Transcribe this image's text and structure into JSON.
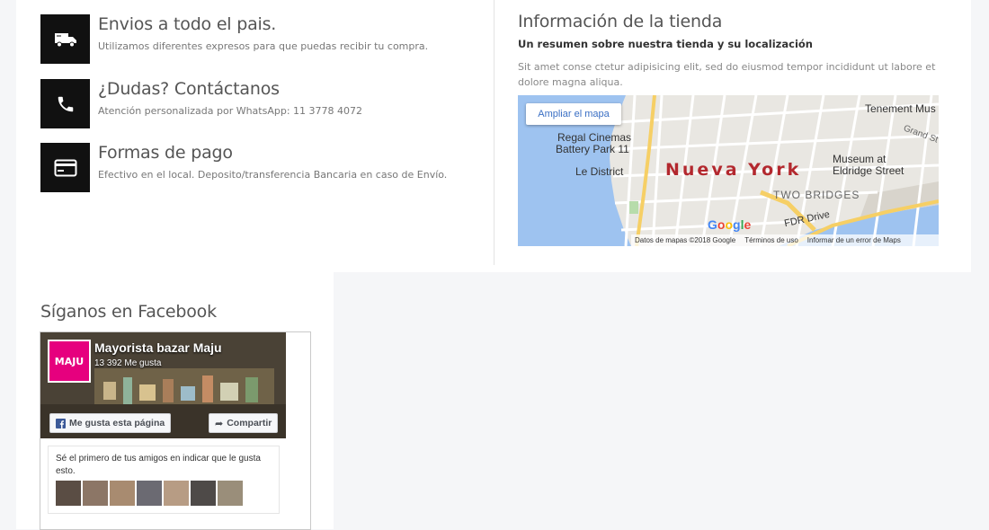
{
  "features": [
    {
      "icon": "truck-icon",
      "title": "Envios a todo el pais.",
      "description": "Utilizamos diferentes expresos para que puedas recibir tu compra."
    },
    {
      "icon": "phone-icon",
      "title": "¿Dudas? Contáctanos",
      "description": "Atención personalizada por WhatsApp: 11 3778 4072"
    },
    {
      "icon": "credit-card-icon",
      "title": "Formas de pago",
      "description": "Efectivo en el local. Deposito/transferencia Bancaria en caso de Envío."
    }
  ],
  "store": {
    "title": "Información de la tienda",
    "subtitle": "Un resumen sobre nuestra tienda y su localización",
    "text": "Sit amet conse ctetur adipisicing elit, sed do eiusmod tempor incididunt ut labore et dolore magna aliqua."
  },
  "map": {
    "enlarge_label": "Ampliar el mapa",
    "labels": {
      "city": "Nueva York",
      "regal": "Regal Cinemas",
      "regal2": "Battery Park 11",
      "le_district": "Le District",
      "museum": "Museum at",
      "museum2": "Eldridge Street",
      "two_bridges": "TWO BRIDGES",
      "tenement": "Tenement Mus",
      "fdr": "FDR Drive",
      "grand": "Grand St"
    },
    "google": "Google",
    "footer": [
      "Datos de mapas ©2018 Google",
      "Términos de uso",
      "Informar de un error de Maps"
    ]
  },
  "facebook": {
    "section_title": "Síganos en Facebook",
    "logo_text": "MAJU",
    "page_name": "Mayorista bazar Maju",
    "likes": "13 392 Me gusta",
    "like_button": "Me gusta esta página",
    "share_button": "Compartir",
    "friends_text": "Sé el primero de tus amigos en indicar que le gusta esto."
  },
  "colors": {
    "icon_bg": "#111111",
    "map_city": "#b3282e",
    "fb_pink": "#e6007e"
  }
}
